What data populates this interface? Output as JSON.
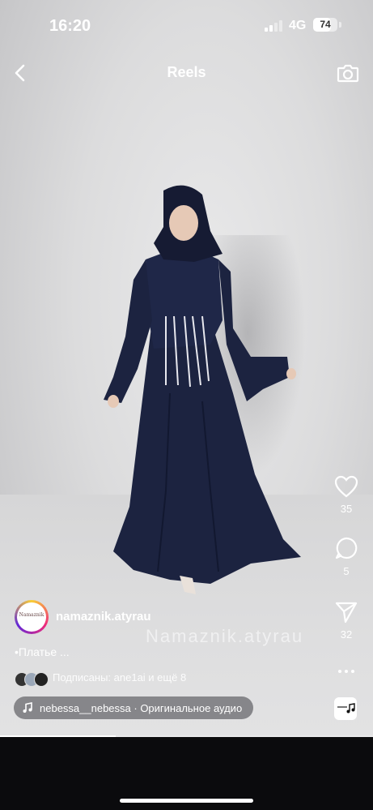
{
  "status_bar": {
    "time": "16:20",
    "network": "4G",
    "battery_level": "74",
    "battery_fraction": 0.74
  },
  "header": {
    "title": "Reels",
    "back_icon": "chevron-left-icon",
    "camera_icon": "camera-icon"
  },
  "actions": {
    "likes": {
      "icon": "heart-icon",
      "count": "35"
    },
    "comments": {
      "icon": "comment-icon",
      "count": "5"
    },
    "shares": {
      "icon": "send-icon",
      "count": "32"
    },
    "more": {
      "icon": "more-dots-icon"
    }
  },
  "post": {
    "username": "namaznik.atyrau",
    "avatar_text": "Namaznik",
    "watermark": "Namaznik.atyrau",
    "caption": "•Платье ...",
    "followers_text": "Подписаны: ane1ai и ещё 8",
    "audio_text": "nebessa__nebessa · Оригинальное аудио"
  },
  "playback": {
    "progress": 0.31
  },
  "colors": {
    "dress": "#1c2340",
    "background": "#dcdcdd",
    "ring_start": "#f9ce34",
    "ring_mid": "#ee2a7b",
    "ring_end": "#6228d7"
  }
}
